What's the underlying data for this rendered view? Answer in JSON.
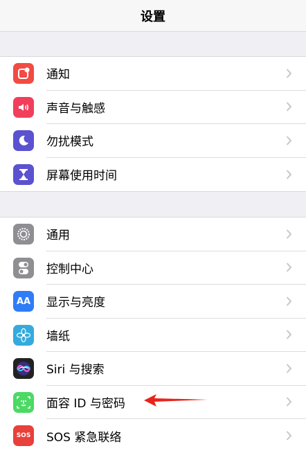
{
  "header": {
    "title": "设置"
  },
  "group1": [
    {
      "label": "通知",
      "icon": "notification-icon",
      "color": "#f24b44"
    },
    {
      "label": "声音与触感",
      "icon": "sound-icon",
      "color": "#f23e5a"
    },
    {
      "label": "勿扰模式",
      "icon": "moon-icon",
      "color": "#5a52cf"
    },
    {
      "label": "屏幕使用时间",
      "icon": "hourglass-icon",
      "color": "#5a52cf"
    }
  ],
  "group2": [
    {
      "label": "通用",
      "icon": "gear-icon",
      "color": "#8e8e93"
    },
    {
      "label": "控制中心",
      "icon": "toggles-icon",
      "color": "#8e8e93"
    },
    {
      "label": "显示与亮度",
      "icon": "aa-icon",
      "color": "#2f7cf6"
    },
    {
      "label": "墙纸",
      "icon": "flower-icon",
      "color": "#36aadc"
    },
    {
      "label": "Siri 与搜索",
      "icon": "siri-icon",
      "color": "#222222"
    },
    {
      "label": "面容 ID 与密码",
      "icon": "faceid-icon",
      "color": "#4cd964"
    },
    {
      "label": "SOS 紧急联络",
      "icon": "sos-icon",
      "color": "#e8403a"
    }
  ],
  "annotation": {
    "arrow_color": "#e8231c"
  },
  "icon_text": {
    "aa": "AA",
    "sos": "SOS"
  }
}
